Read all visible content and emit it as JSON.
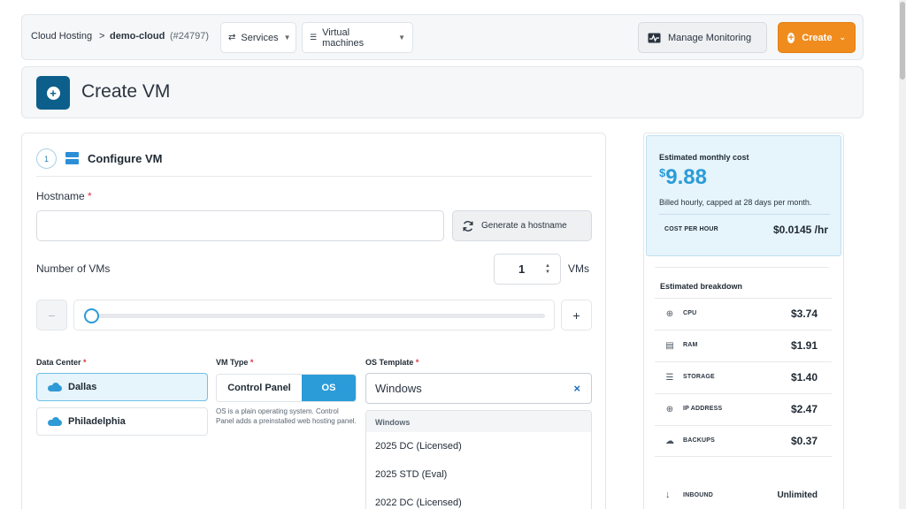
{
  "breadcrumb": {
    "root": "Cloud Hosting",
    "separator": ">",
    "project": "demo-cloud",
    "project_id": "(#24797)"
  },
  "nav": {
    "services_label": "Services",
    "vms_label": "Virtual machines",
    "monitoring_label": "Manage Monitoring",
    "create_label": "Create"
  },
  "page": {
    "title": "Create VM"
  },
  "step": {
    "number": "1",
    "title": "Configure VM"
  },
  "form": {
    "hostname_label": "Hostname",
    "required_mark": "*",
    "hostname_value": "",
    "generate_label": "Generate a hostname",
    "num_vms_label": "Number of VMs",
    "num_vms_value": "1",
    "num_vms_unit": "VMs",
    "minus_label": "−",
    "plus_label": "+",
    "slider_fraction": 0.0,
    "datacenter_label": "Data Center",
    "datacenters": [
      "Dallas",
      "Philadelphia"
    ],
    "datacenter_selected": "Dallas",
    "vm_type_label": "VM Type",
    "vm_types": [
      "Control Panel",
      "OS"
    ],
    "vm_type_selected": "OS",
    "vm_type_help": "OS is a plain operating system. Control Panel adds a preinstalled web hosting panel.",
    "os_template_label": "OS Template",
    "os_template_value": "Windows",
    "os_clear": "×",
    "os_menu": {
      "group": "Windows",
      "items": [
        "2025 DC (Licensed)",
        "2025 STD (Eval)",
        "2022 DC (Licensed)"
      ]
    }
  },
  "cost": {
    "label": "Estimated monthly cost",
    "currency": "$",
    "amount": "9.88",
    "note": "Billed hourly, capped at 28 days per month.",
    "per_hour_label": "COST PER HOUR",
    "per_hour_value": "$0.0145 /hr"
  },
  "breakdown": {
    "title": "Estimated breakdown",
    "rows": [
      {
        "name": "CPU",
        "price": "$3.74",
        "icon": "cpu-icon"
      },
      {
        "name": "RAM",
        "price": "$1.91",
        "icon": "ram-icon"
      },
      {
        "name": "STORAGE",
        "price": "$1.40",
        "icon": "storage-icon"
      },
      {
        "name": "IP ADDRESS",
        "price": "$2.47",
        "icon": "globe-icon"
      },
      {
        "name": "BACKUPS",
        "price": "$0.37",
        "icon": "cloud-upload-icon"
      }
    ],
    "inbound_label": "INBOUND",
    "inbound_value": "Unlimited"
  },
  "colors": {
    "accent": "#2b9cd8",
    "create_button": "#f08c1d",
    "title_icon_bg": "#0c5f8b"
  }
}
